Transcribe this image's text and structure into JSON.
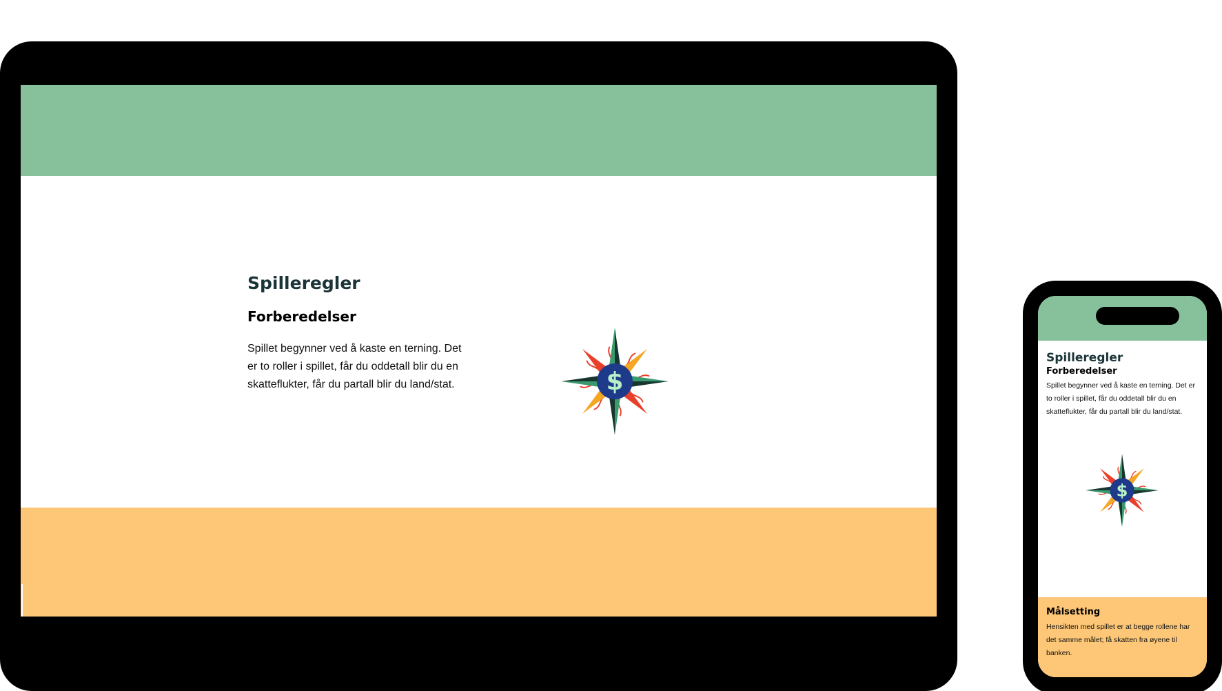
{
  "tablet": {
    "title": "Spilleregler",
    "subtitle": "Forberedelser",
    "body": "Spillet begynner ved å kaste en terning. Det er to roller i spillet, får du oddetall blir du en skatteflukter, får du partall blir du land/stat.",
    "compass_symbol": "$"
  },
  "phone": {
    "title": "Spilleregler",
    "subtitle": "Forberedelser",
    "body": "Spillet begynner ved å kaste en terning. Det er to roller i spillet, får du oddetall blir du en skatteflukter, får du partall blir du land/stat.",
    "compass_symbol": "$",
    "footer_title": "Målsetting",
    "footer_body": "Hensikten med spillet er at begge rollene har det samme målet; få skatten fra øyene til banken."
  },
  "colors": {
    "header_green": "#86c19c",
    "footer_orange": "#fdc777",
    "title_dark": "#1b3438",
    "compass_navy": "#1e3a8a",
    "compass_green": "#3a9a6e",
    "compass_dark": "#17362f",
    "compass_orange": "#f5a623",
    "compass_red": "#e8402a",
    "dollar_mint": "#b8f0c8"
  },
  "icons": {
    "compass": "compass-rose-dollar-icon"
  }
}
